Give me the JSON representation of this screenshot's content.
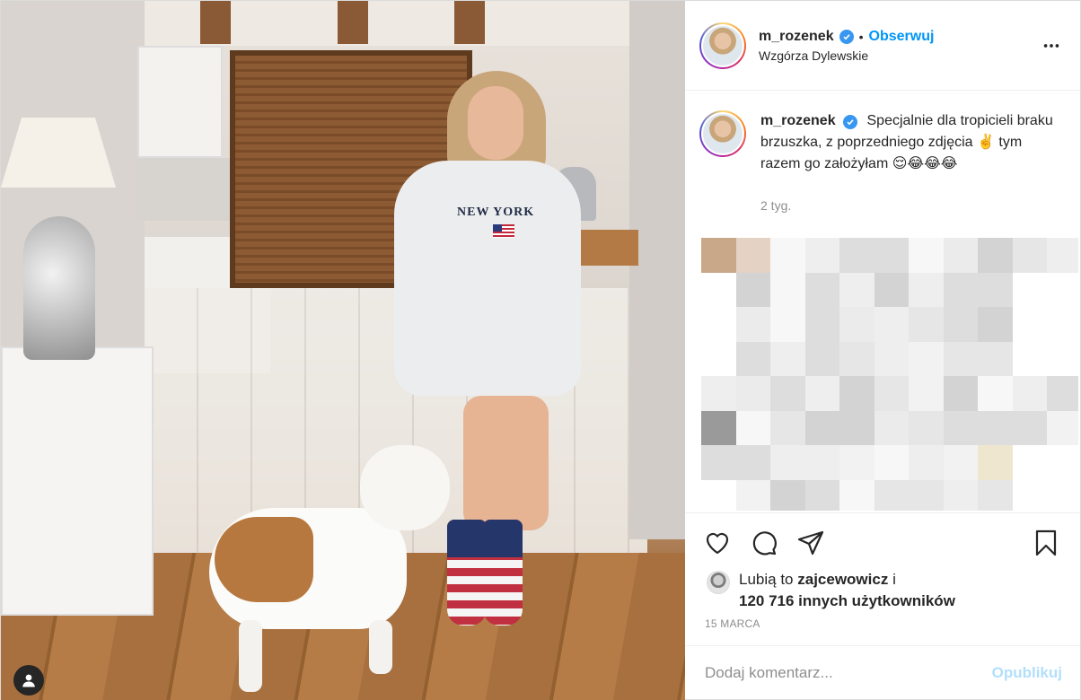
{
  "post": {
    "username": "m_rozenek",
    "separator": "•",
    "follow_label": "Obserwuj",
    "location": "Wzgórza Dylewskie",
    "photo_text": "NEW YORK"
  },
  "caption": {
    "username": "m_rozenek",
    "text": "Specjalnie dla tropicieli braku brzuszka, z poprzedniego zdjęcia ✌️ tym razem go założyłam 😌😂😂😂",
    "time": "2 tyg."
  },
  "likes": {
    "prefix": "Lubią to ",
    "user": "zajcewowicz",
    "connector": " i",
    "count_text": "120 716 innych użytkowników"
  },
  "date": "15 MARCA",
  "comment": {
    "placeholder": "Dodaj komentarz...",
    "post_label": "Opublikuj"
  },
  "colors": {
    "link": "#0095f6",
    "verified": "#3897f0",
    "muted": "#8e8e8e",
    "post_disabled": "#b2dffc"
  },
  "icons": [
    "verified-badge-icon",
    "more-options-icon",
    "heart-icon",
    "comment-icon",
    "share-icon",
    "bookmark-icon",
    "user-icon"
  ]
}
